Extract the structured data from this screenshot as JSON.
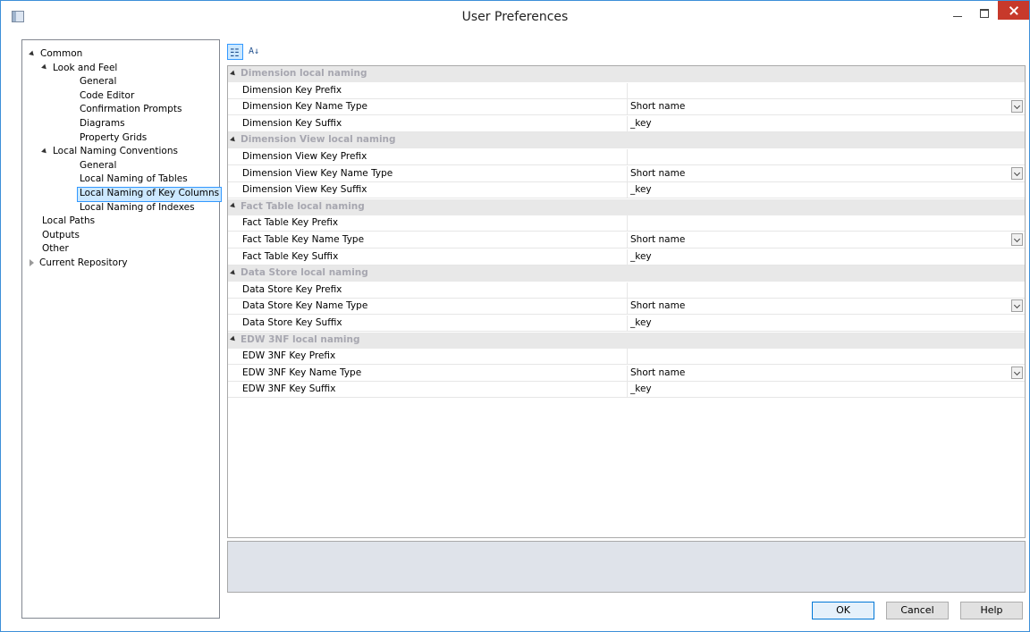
{
  "window": {
    "title": "User Preferences"
  },
  "tree": {
    "items": [
      {
        "label": "Common",
        "level": 0,
        "expander": "open",
        "selected": false
      },
      {
        "label": "Look and Feel",
        "level": 1,
        "expander": "open",
        "selected": false
      },
      {
        "label": "General",
        "level": 2,
        "expander": "none",
        "selected": false
      },
      {
        "label": "Code Editor",
        "level": 2,
        "expander": "none",
        "selected": false
      },
      {
        "label": "Confirmation Prompts",
        "level": 2,
        "expander": "none",
        "selected": false
      },
      {
        "label": "Diagrams",
        "level": 2,
        "expander": "none",
        "selected": false
      },
      {
        "label": "Property Grids",
        "level": 2,
        "expander": "none",
        "selected": false
      },
      {
        "label": "Local Naming Conventions",
        "level": 1,
        "expander": "open",
        "selected": false
      },
      {
        "label": "General",
        "level": 2,
        "expander": "none",
        "selected": false
      },
      {
        "label": "Local Naming of Tables",
        "level": 2,
        "expander": "none",
        "selected": false
      },
      {
        "label": "Local Naming of Key Columns",
        "level": 2,
        "expander": "none",
        "selected": true
      },
      {
        "label": "Local Naming of Indexes",
        "level": 2,
        "expander": "none",
        "selected": false
      },
      {
        "label": "Local Paths",
        "level": 1,
        "expander": "none",
        "selected": false
      },
      {
        "label": "Outputs",
        "level": 1,
        "expander": "none",
        "selected": false
      },
      {
        "label": "Other",
        "level": 1,
        "expander": "none",
        "selected": false
      },
      {
        "label": "Current Repository",
        "level": 0,
        "expander": "closed",
        "selected": false
      }
    ]
  },
  "toolbar": {
    "categorized_icon": "categorized-view-icon",
    "alphabetical_icon": "alphabetical-sort-icon"
  },
  "grid": {
    "categories": [
      {
        "name": "Dimension local naming",
        "props": [
          {
            "name": "Dimension Key Prefix",
            "value": "",
            "dropdown": false
          },
          {
            "name": "Dimension Key Name Type",
            "value": "Short name",
            "dropdown": true
          },
          {
            "name": "Dimension Key Suffix",
            "value": "_key",
            "dropdown": false
          }
        ]
      },
      {
        "name": "Dimension View local naming",
        "props": [
          {
            "name": "Dimension View Key Prefix",
            "value": "",
            "dropdown": false
          },
          {
            "name": "Dimension View Key Name Type",
            "value": "Short name",
            "dropdown": true
          },
          {
            "name": "Dimension View Key Suffix",
            "value": "_key",
            "dropdown": false
          }
        ]
      },
      {
        "name": "Fact Table local naming",
        "props": [
          {
            "name": "Fact Table Key Prefix",
            "value": "",
            "dropdown": false
          },
          {
            "name": "Fact Table Key Name Type",
            "value": "Short name",
            "dropdown": true
          },
          {
            "name": "Fact Table Key Suffix",
            "value": "_key",
            "dropdown": false
          }
        ]
      },
      {
        "name": "Data Store local naming",
        "props": [
          {
            "name": "Data Store Key Prefix",
            "value": "",
            "dropdown": false
          },
          {
            "name": "Data Store Key Name Type",
            "value": "Short name",
            "dropdown": true
          },
          {
            "name": "Data Store Key Suffix",
            "value": "_key",
            "dropdown": false
          }
        ]
      },
      {
        "name": "EDW 3NF local naming",
        "props": [
          {
            "name": "EDW 3NF Key Prefix",
            "value": "",
            "dropdown": false
          },
          {
            "name": "EDW 3NF Key Name Type",
            "value": "Short name",
            "dropdown": true
          },
          {
            "name": "EDW 3NF Key Suffix",
            "value": "_key",
            "dropdown": false
          }
        ]
      }
    ]
  },
  "buttons": {
    "ok": "OK",
    "cancel": "Cancel",
    "help": "Help"
  }
}
